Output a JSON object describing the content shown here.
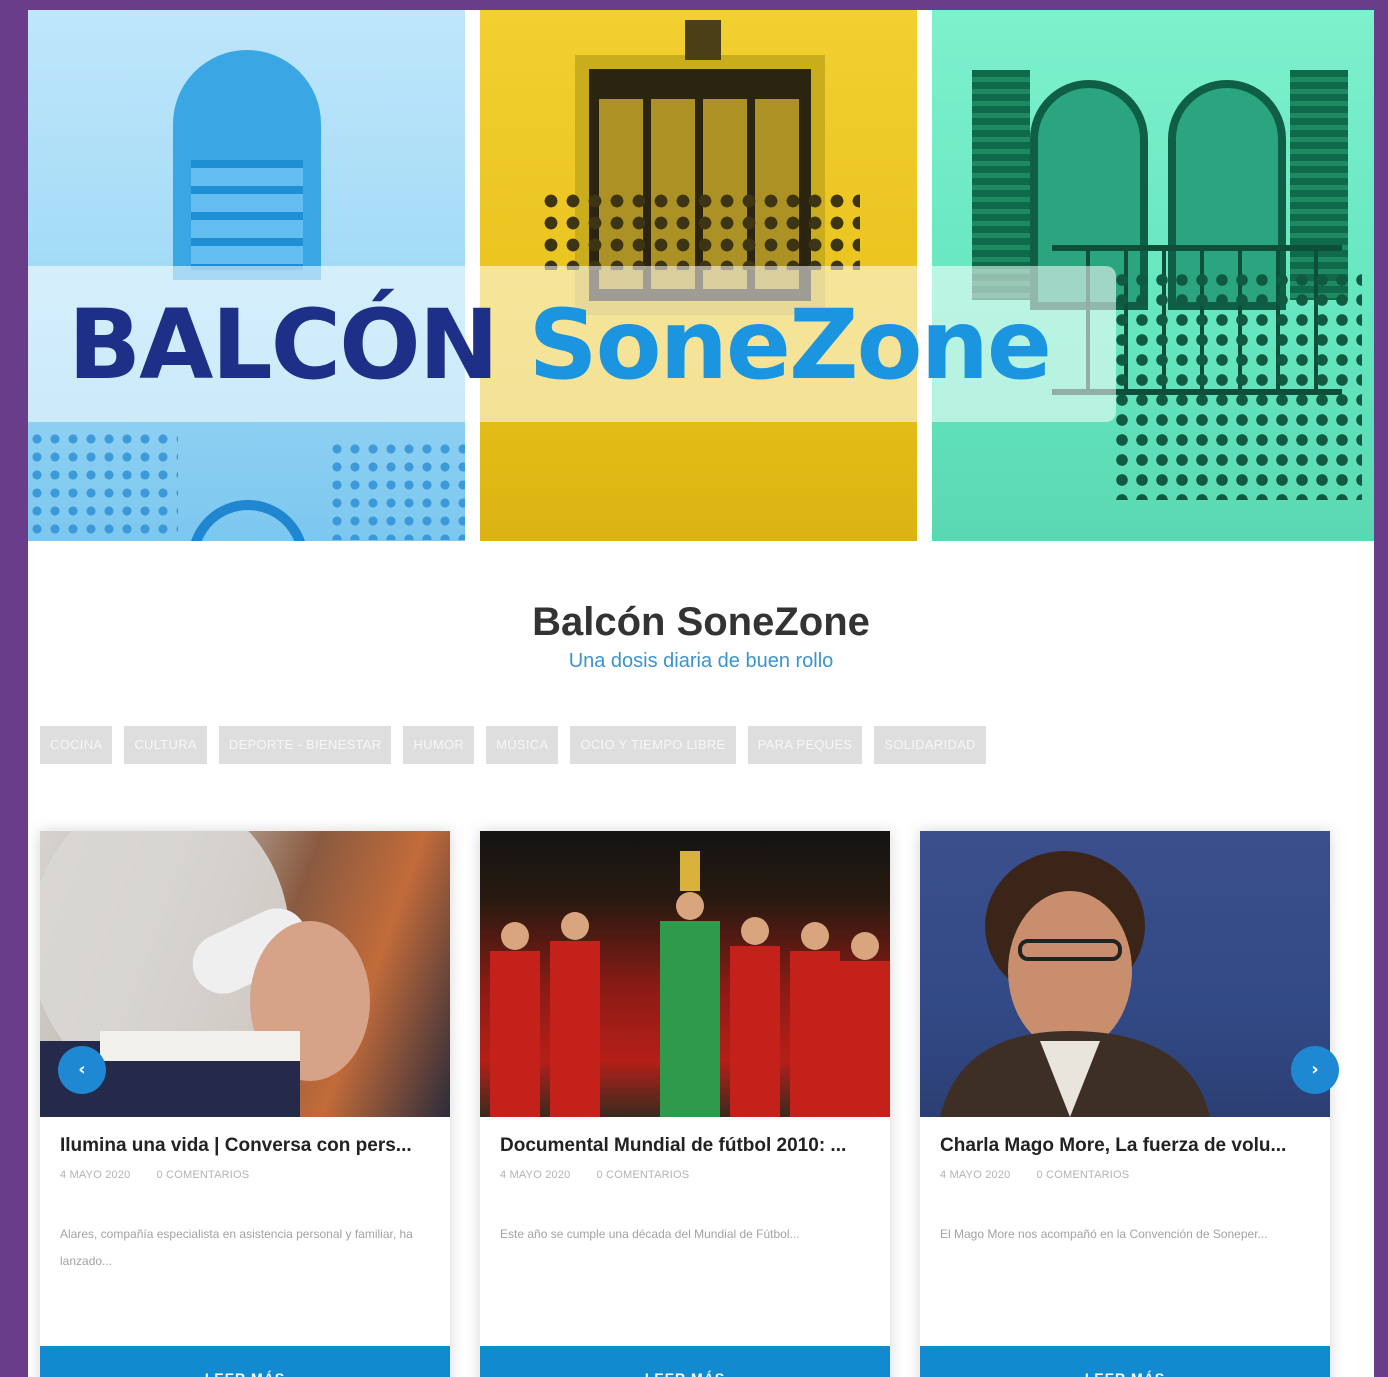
{
  "banner": {
    "logo_word_1": "BALCÓN",
    "logo_word_2": "SoneZone"
  },
  "site": {
    "title": "Balcón SoneZone",
    "tagline": "Una dosis diaria de buen rollo"
  },
  "categories": [
    "COCINA",
    "CULTURA",
    "DEPORTE - BIENESTAR",
    "HUMOR",
    "MÚSICA",
    "OCIO Y TIEMPO LIBRE",
    "PARA PEQUES",
    "SOLIDARIDAD"
  ],
  "carousel": {
    "prev_icon": "chevron-left-icon",
    "next_icon": "chevron-right-icon",
    "prev_glyph": "‹",
    "next_glyph": "›",
    "cards": [
      {
        "title": "Ilumina una vida | Conversa con pers...",
        "date": "4 MAYO 2020",
        "comments": "0 COMENTARIOS",
        "excerpt": "Alares, compañía especialista en asistencia personal y familiar, ha lanzado...",
        "read_more": "LEER MÁS"
      },
      {
        "title": "Documental Mundial de fútbol 2010: ...",
        "date": "4 MAYO 2020",
        "comments": "0 COMENTARIOS",
        "excerpt": "Este año se cumple una década del Mundial de Fútbol...",
        "read_more": "LEER MÁS"
      },
      {
        "title": "Charla Mago More, La fuerza de volu...",
        "date": "4 MAYO 2020",
        "comments": "0 COMENTARIOS",
        "excerpt": "El Mago More nos acompañó en la Convención de Soneper...",
        "read_more": "LEER MÁS"
      }
    ]
  },
  "colors": {
    "frame_purple": "#6a3d8a",
    "brand_navy": "#1e2f87",
    "brand_blue": "#1b95df",
    "button_blue": "#118ad0"
  }
}
